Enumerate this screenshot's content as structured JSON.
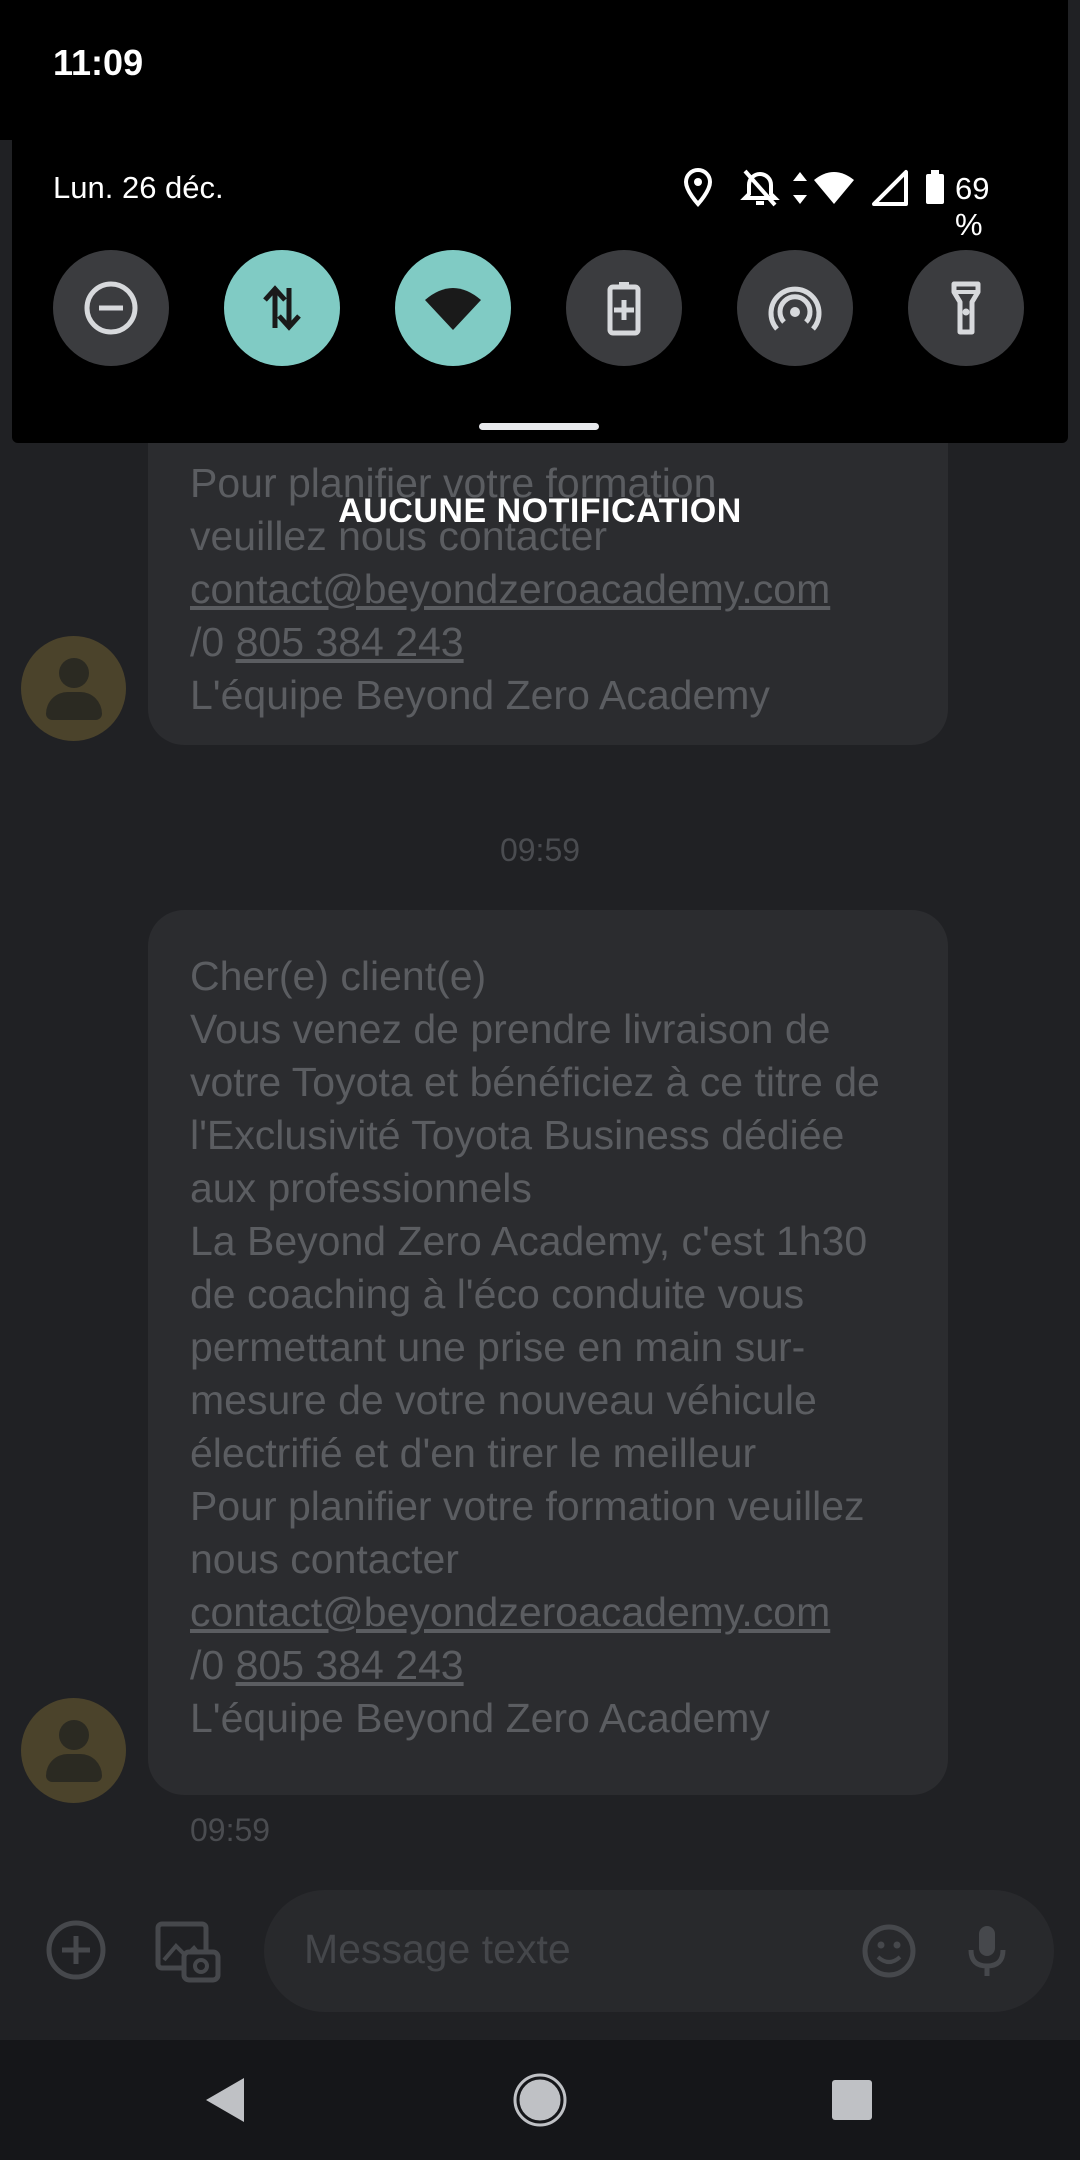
{
  "status_bar": {
    "time": "11:09",
    "date": "Lun. 26 déc.",
    "battery_percent": "69 %",
    "icons": [
      "location-icon",
      "alarm-off-icon",
      "data-arrows-icon",
      "wifi-icon",
      "signal-icon",
      "battery-icon"
    ]
  },
  "quick_settings": {
    "tiles": [
      {
        "name": "do-not-disturb",
        "icon": "minus-circle-icon",
        "active": false
      },
      {
        "name": "mobile-data",
        "icon": "data-arrows-icon",
        "active": true
      },
      {
        "name": "wifi",
        "icon": "wifi-icon",
        "active": true
      },
      {
        "name": "battery-saver",
        "icon": "battery-plus-icon",
        "active": false
      },
      {
        "name": "hotspot",
        "icon": "hotspot-icon",
        "active": false
      },
      {
        "name": "flashlight",
        "icon": "flashlight-icon",
        "active": false
      }
    ]
  },
  "notifications": {
    "empty_label": "AUCUNE NOTIFICATION"
  },
  "conversation": {
    "message1": {
      "line1": "Pour planifier votre formation",
      "line2": "veuillez nous contacter",
      "email": "contact@beyondzeroacademy.com",
      "phone_prefix": "/0 ",
      "phone": "805 384 243",
      "signature": "L'équipe Beyond Zero Academy"
    },
    "divider_time": "09:59",
    "message2": {
      "body": "Cher(e) client(e)\nVous venez de prendre livraison de votre Toyota et bénéficiez à ce titre de l'Exclusivité Toyota Business dédiée aux professionnels\nLa Beyond Zero Academy, c'est 1h30 de coaching à l'éco conduite vous permettant une prise en main sur-mesure de votre nouveau véhicule électrifié et d'en tirer le meilleur\nPour planifier votre formation veuillez nous contacter",
      "email": "contact@beyondzeroacademy.com",
      "phone_prefix": "/0 ",
      "phone": "805 384 243",
      "signature": "L'équipe Beyond Zero Academy",
      "time": "09:59"
    }
  },
  "composer": {
    "placeholder": "Message texte"
  },
  "colors": {
    "accent_tile": "#80cbc4",
    "tile_off": "#3b3c3f",
    "shade_bg": "#000000",
    "app_bg": "#202124"
  }
}
